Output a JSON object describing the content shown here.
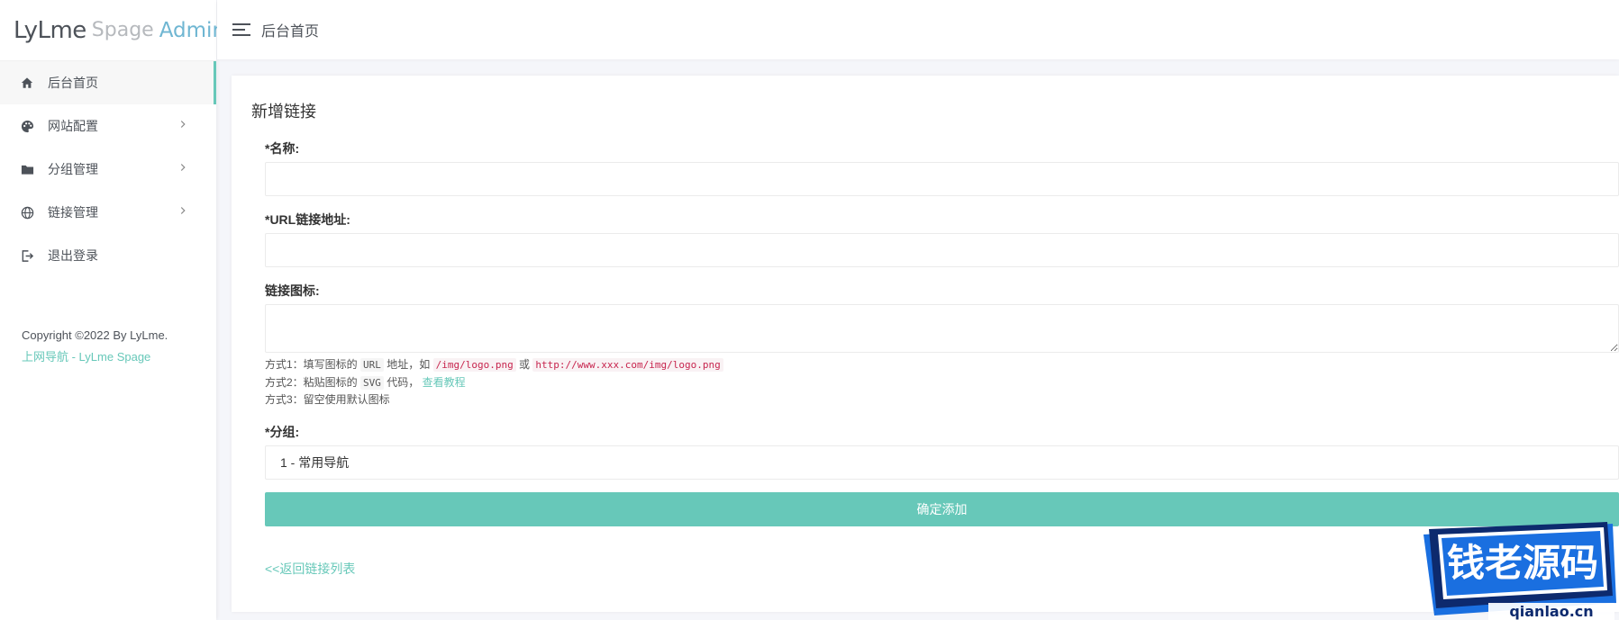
{
  "sidebar": {
    "logo": {
      "part1": "LyLme",
      "part2": "Spage",
      "part3": "Admin"
    },
    "items": [
      {
        "label": "后台首页",
        "icon": "home-icon",
        "active": true,
        "has_submenu": false
      },
      {
        "label": "网站配置",
        "icon": "palette-icon",
        "active": false,
        "has_submenu": true
      },
      {
        "label": "分组管理",
        "icon": "folder-icon",
        "active": false,
        "has_submenu": true
      },
      {
        "label": "链接管理",
        "icon": "globe-icon",
        "active": false,
        "has_submenu": true
      },
      {
        "label": "退出登录",
        "icon": "logout-icon",
        "active": false,
        "has_submenu": false
      }
    ],
    "copyright": "Copyright ©2022 By LyLme.",
    "copyright_link": "上网导航 - LyLme Spage"
  },
  "header": {
    "title": "后台首页",
    "menu_icon": "menu-icon"
  },
  "card": {
    "title": "新增链接",
    "fields": {
      "name_label": "*名称:",
      "name_value": "",
      "url_label": "*URL链接地址:",
      "url_value": "",
      "icon_label": "链接图标:",
      "icon_value": "",
      "group_label": "*分组:",
      "group_selected": "1 - 常用导航"
    },
    "help": {
      "line1_prefix": "方式1：填写图标的",
      "line1_code1": "URL",
      "line1_mid": "地址，如",
      "line1_code2": "/img/logo.png",
      "line1_or": "或",
      "line1_code3": "http://www.xxx.com/img/logo.png",
      "line2_prefix": "方式2：粘贴图标的",
      "line2_code": "SVG",
      "line2_mid": "代码，",
      "line2_link": "查看教程",
      "line3": "方式3：留空使用默认图标"
    },
    "submit_label": "确定添加",
    "back_link": "<<返回链接列表"
  },
  "watermark": {
    "title": "钱老源码",
    "subtitle": "qianlao.cn",
    "colors": {
      "blue": "#1a6fe0",
      "dark": "#0d2a6e"
    }
  },
  "colors": {
    "accent": "#67c8b9",
    "logo_admin": "#6fb6d2"
  }
}
